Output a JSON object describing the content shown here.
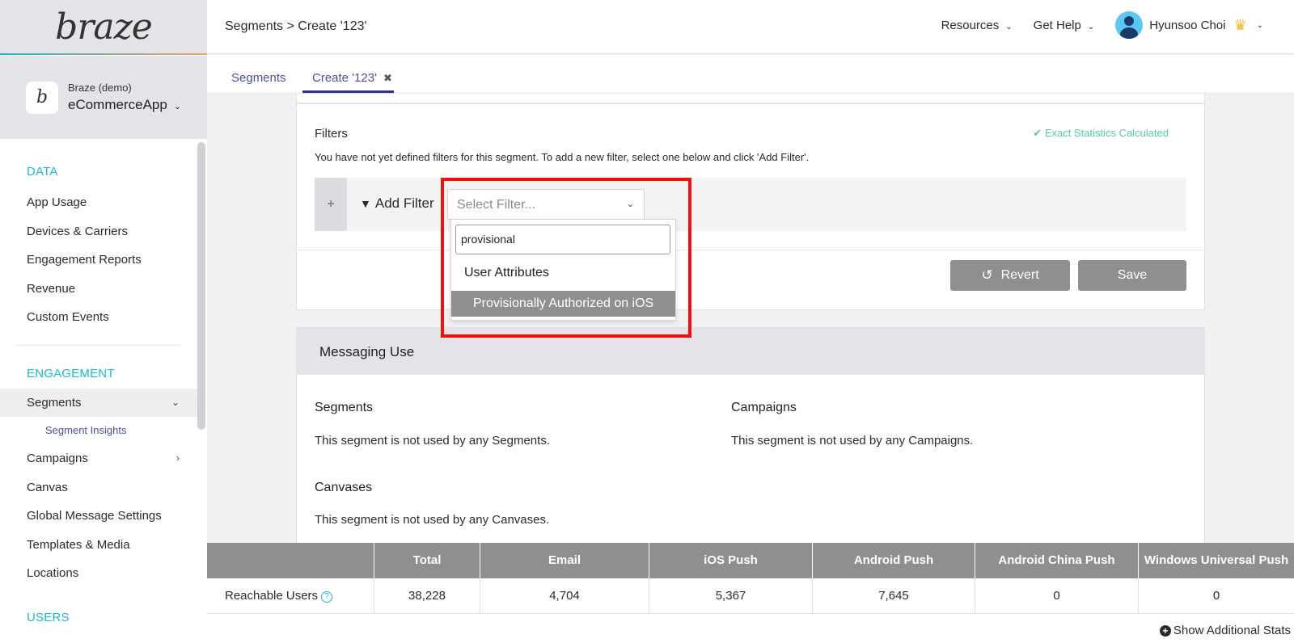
{
  "sidebar": {
    "logo": "braze",
    "app_org": "Braze (demo)",
    "app_name": "eCommerceApp",
    "sections": [
      {
        "title": "DATA",
        "items": [
          "App Usage",
          "Devices & Carriers",
          "Engagement Reports",
          "Revenue",
          "Custom Events"
        ]
      },
      {
        "title": "ENGAGEMENT",
        "items": [
          "Segments",
          "Segment Insights",
          "Campaigns",
          "Canvas",
          "Global Message Settings",
          "Templates & Media",
          "Locations"
        ]
      },
      {
        "title": "USERS"
      }
    ]
  },
  "header": {
    "breadcrumb": "Segments > Create '123'",
    "resources": "Resources",
    "get_help": "Get Help",
    "user_name": "Hyunsoo Choi"
  },
  "tabs": [
    "Segments",
    "Create '123'"
  ],
  "filters": {
    "title": "Filters",
    "status": "Exact Statistics Calculated",
    "description": "You have not yet defined filters for this segment. To add a new filter, select one below and click 'Add Filter'.",
    "add_filter": "Add Filter",
    "select_placeholder": "Select Filter...",
    "revert": "Revert",
    "save": "Save",
    "dropdown": {
      "search_value": "provisional",
      "group": "User Attributes",
      "option": "Provisionally Authorized on iOS"
    }
  },
  "messaging": {
    "title": "Messaging Use",
    "segments_title": "Segments",
    "segments_text": "This segment is not used by any Segments.",
    "campaigns_title": "Campaigns",
    "campaigns_text": "This segment is not used by any Campaigns.",
    "canvases_title": "Canvases",
    "canvases_text": "This segment is not used by any Canvases."
  },
  "stats": {
    "columns": [
      "Total",
      "Email",
      "iOS Push",
      "Android Push",
      "Android China Push",
      "Windows Universal Push"
    ],
    "row_label": "Reachable Users",
    "values": [
      "38,228",
      "4,704",
      "5,367",
      "7,645",
      "0",
      "0"
    ],
    "more": "Show Additional Stats"
  },
  "colors": {
    "accent": "#17b9cc",
    "link": "#4a50a6",
    "success": "#4fcf9a",
    "highlight": "#ee1111",
    "button": "#8f8f92"
  }
}
